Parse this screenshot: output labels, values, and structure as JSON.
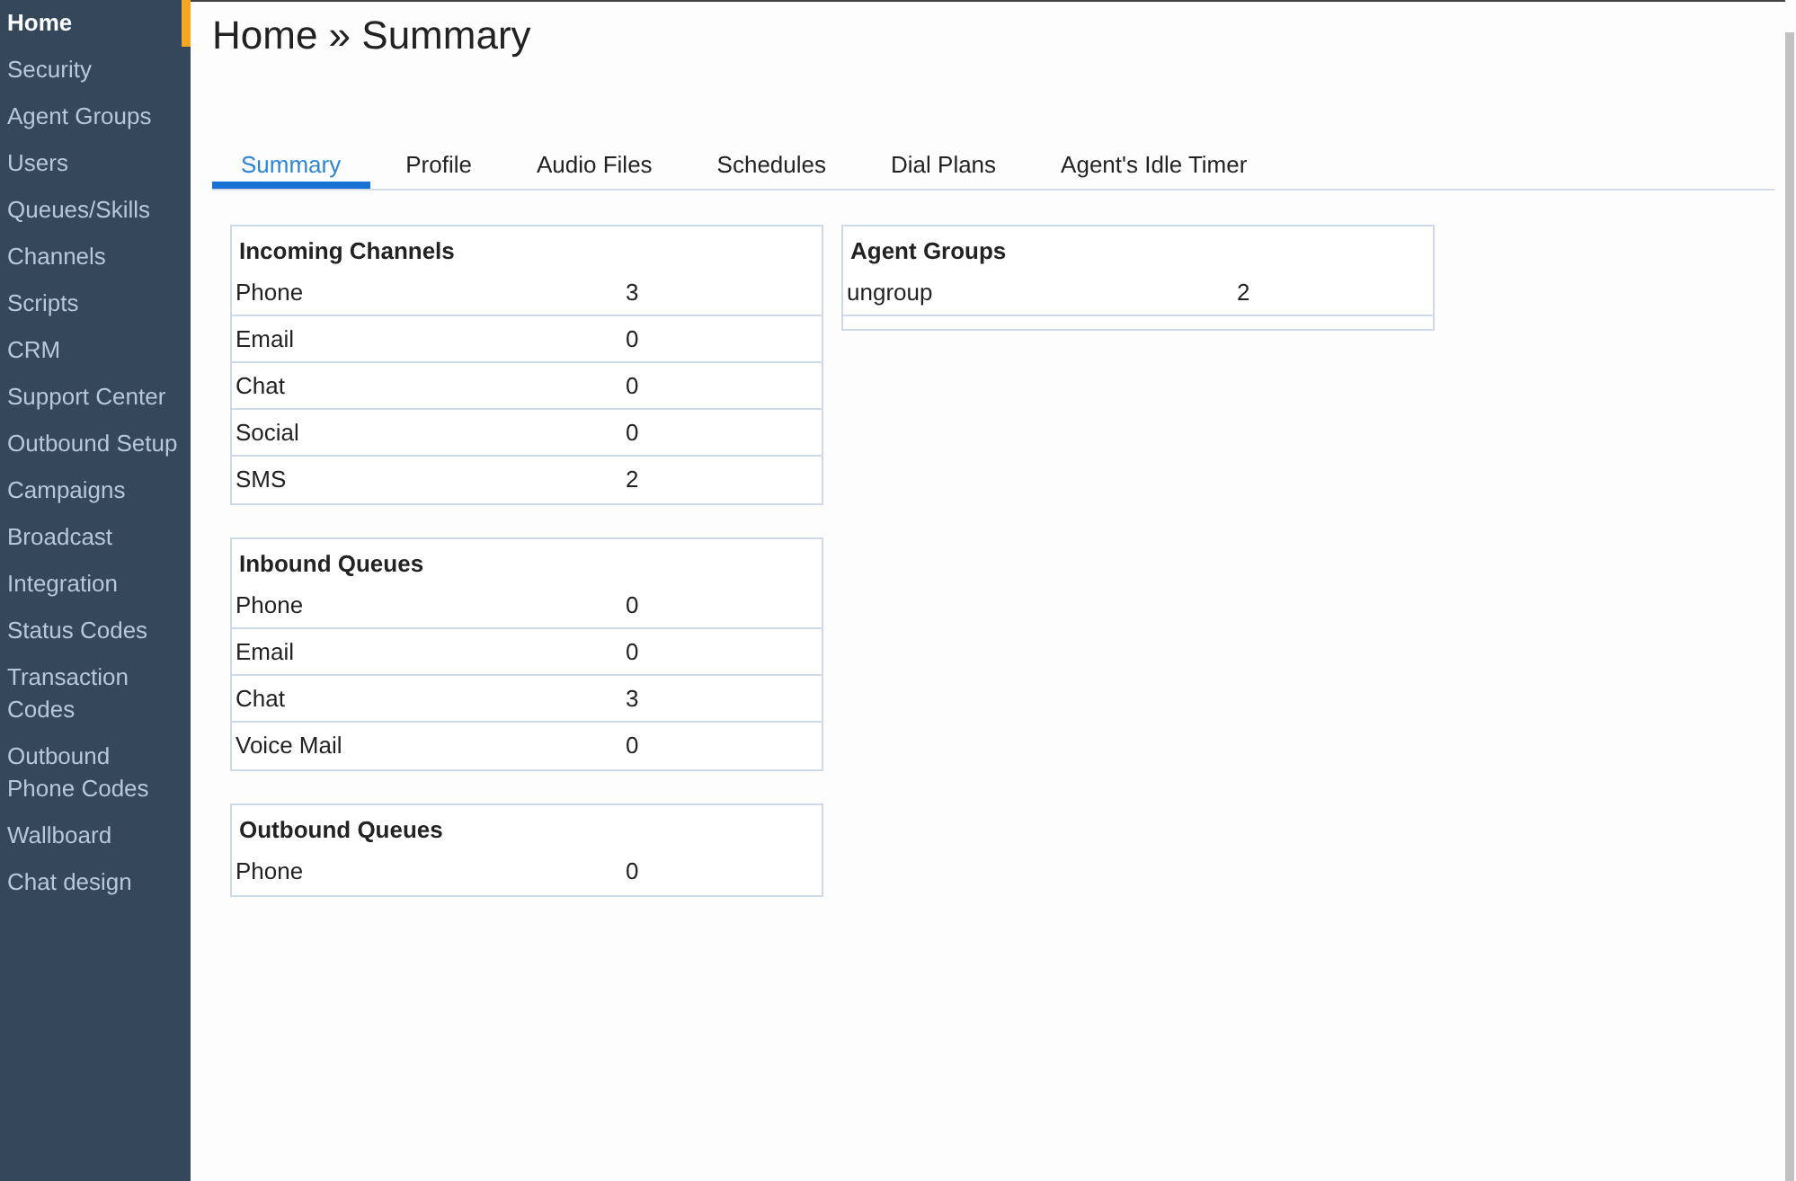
{
  "sidebar": {
    "items": [
      {
        "label": "Home",
        "selected": true
      },
      {
        "label": "Security",
        "selected": false
      },
      {
        "label": "Agent Groups",
        "selected": false
      },
      {
        "label": "Users",
        "selected": false
      },
      {
        "label": "Queues/Skills",
        "selected": false
      },
      {
        "label": "Channels",
        "selected": false
      },
      {
        "label": "Scripts",
        "selected": false
      },
      {
        "label": "CRM",
        "selected": false
      },
      {
        "label": "Support Center",
        "selected": false
      },
      {
        "label": "Outbound Setup",
        "selected": false
      },
      {
        "label": "Campaigns",
        "selected": false
      },
      {
        "label": "Broadcast",
        "selected": false
      },
      {
        "label": "Integration",
        "selected": false
      },
      {
        "label": "Status Codes",
        "selected": false
      },
      {
        "label": "Transaction Codes",
        "selected": false
      },
      {
        "label": "Outbound Phone Codes",
        "selected": false
      },
      {
        "label": "Wallboard",
        "selected": false
      },
      {
        "label": "Chat design",
        "selected": false
      }
    ]
  },
  "page_title": "Home » Summary",
  "tabs": [
    {
      "label": "Summary",
      "selected": true
    },
    {
      "label": "Profile",
      "selected": false
    },
    {
      "label": "Audio Files",
      "selected": false
    },
    {
      "label": "Schedules",
      "selected": false
    },
    {
      "label": "Dial Plans",
      "selected": false
    },
    {
      "label": "Agent's Idle Timer",
      "selected": false
    }
  ],
  "left_panels": [
    {
      "title": "Incoming Channels",
      "rows": [
        {
          "name": "Phone",
          "value": "3"
        },
        {
          "name": "Email",
          "value": "0"
        },
        {
          "name": "Chat",
          "value": "0"
        },
        {
          "name": "Social",
          "value": "0"
        },
        {
          "name": "SMS",
          "value": "2"
        }
      ]
    },
    {
      "title": "Inbound Queues",
      "rows": [
        {
          "name": "Phone",
          "value": "0"
        },
        {
          "name": "Email",
          "value": "0"
        },
        {
          "name": "Chat",
          "value": "3"
        },
        {
          "name": "Voice Mail",
          "value": "0"
        }
      ]
    },
    {
      "title": "Outbound Queues",
      "rows": [
        {
          "name": "Phone",
          "value": "0"
        }
      ]
    }
  ],
  "right_panels": [
    {
      "title": "Agent Groups",
      "rows": [
        {
          "name": "ungroup",
          "value": "2"
        }
      ]
    }
  ]
}
